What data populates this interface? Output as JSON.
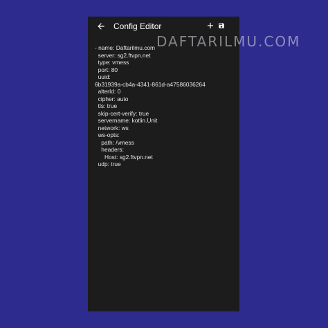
{
  "app": {
    "title": "Config Editor"
  },
  "toolbar": {
    "back_icon": "arrow-back-icon",
    "add_icon": "add-icon",
    "save_icon": "save-icon"
  },
  "editor": {
    "content": "- name: Daftarilmu.com\n  server: sg2.ftvpn.net\n  type: vmess\n  port: 80\n  uuid:\n6b31939a-cb4a-4341-861d-a47586036264\n  alterId: 0\n  cipher: auto\n  tls: true\n  skip-cert-verify: true\n  servername: kotlin.Unit\n  network: ws\n  ws-opts:\n    path: /vmess\n    headers:\n      Host: sg2.ftvpn.net\n  udp: true"
  },
  "watermark": {
    "text": "DAFTARILMU.COM"
  },
  "colors": {
    "background": "#2e2b8e",
    "phone_background": "#1c1c1c",
    "text": "#e6e6e6"
  }
}
